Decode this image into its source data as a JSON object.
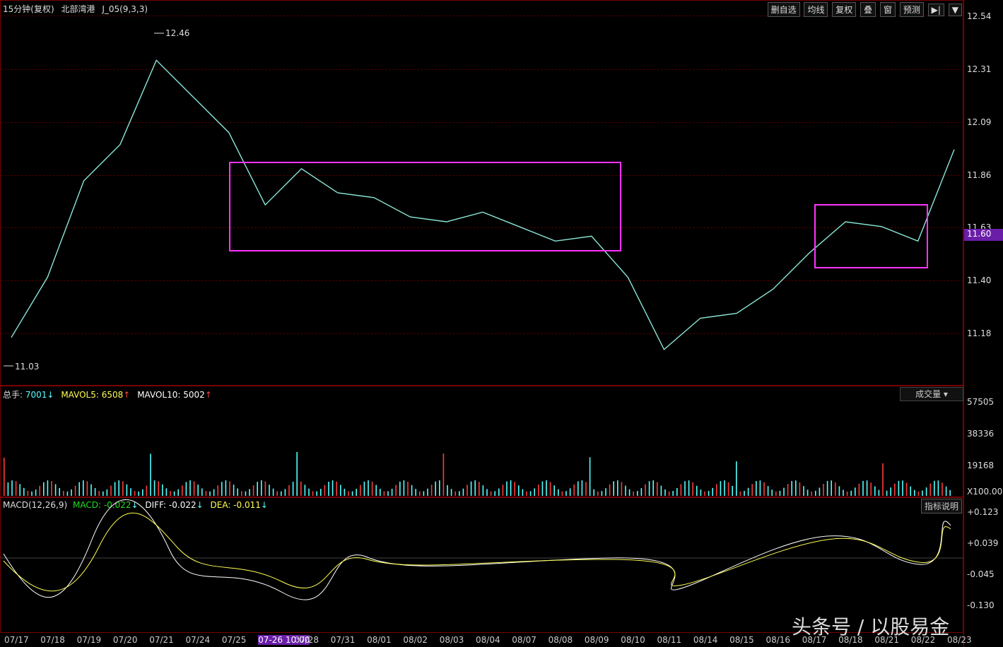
{
  "header": {
    "left_title": "15分钟(复权)",
    "symbol": "北部湾港",
    "indicator": "J_05(9,3,3)"
  },
  "toolbar": {
    "items": [
      "删自选",
      "均线",
      "复权",
      "叠",
      "窗",
      "预测"
    ]
  },
  "price_panel": {
    "high_label": "12.46",
    "low_label": "11.03",
    "y_ticks": [
      "12.54",
      "12.31",
      "12.09",
      "11.86",
      "11.63",
      "11.40",
      "11.18"
    ],
    "current_price": "11.60"
  },
  "volume_panel": {
    "title_parts": {
      "a": "总手:",
      "b": "7001",
      "c": "MAVOL5:",
      "d": "6508",
      "e": "MAVOL10:",
      "f": "5002"
    },
    "dropdown": "成交量",
    "y_ticks": [
      "57505",
      "38336",
      "19168"
    ],
    "unit": "X100.00"
  },
  "macd_panel": {
    "title_parts": {
      "a": "MACD(12,26,9)",
      "b": "MACD:",
      "c": "-0.022",
      "d": "DIFF:",
      "e": "-0.022",
      "f": "DEA:",
      "g": "-0.011"
    },
    "button": "指标说明",
    "y_ticks": [
      "+0.123",
      "+0.039",
      "-0.045",
      "-0.130"
    ]
  },
  "x_axis": {
    "dates": [
      "07/17",
      "07/18",
      "07/19",
      "07/20",
      "07/21",
      "07/24",
      "07/25",
      "07-26 10:00",
      "07/28",
      "07/31",
      "08/01",
      "08/02",
      "08/03",
      "08/04",
      "08/07",
      "08/08",
      "08/09",
      "08/10",
      "08/11",
      "08/14",
      "08/15",
      "08/16",
      "08/17",
      "08/18",
      "08/21",
      "08/22",
      "08/23"
    ]
  },
  "watermark": "头条号 / 以股易金",
  "colors": {
    "up": "#ff3b3b",
    "down": "#54ffff",
    "box": "#ff33ff",
    "buy_arrow": "#ff4040",
    "sell_arrow": "#22dd22",
    "current": "#6a1ea8"
  },
  "chart_data": {
    "type": "candlestick",
    "interval": "15min",
    "price_annotations": {
      "high": 12.46,
      "low": 11.03,
      "last": 11.6
    },
    "ylim": [
      11.0,
      12.6
    ],
    "approx_close_path": [
      {
        "x": "07/17",
        "y": 11.2
      },
      {
        "x": "07/18",
        "y": 11.45
      },
      {
        "x": "07/19",
        "y": 11.85
      },
      {
        "x": "07/20",
        "y": 12.0
      },
      {
        "x": "07/21",
        "y": 12.35
      },
      {
        "x": "07/24",
        "y": 12.2
      },
      {
        "x": "07/25",
        "y": 12.05
      },
      {
        "x": "07-26 10:00",
        "y": 11.75
      },
      {
        "x": "07/28",
        "y": 11.9
      },
      {
        "x": "07/31",
        "y": 11.8
      },
      {
        "x": "08/01",
        "y": 11.78
      },
      {
        "x": "08/02",
        "y": 11.7
      },
      {
        "x": "08/03",
        "y": 11.68
      },
      {
        "x": "08/04",
        "y": 11.72
      },
      {
        "x": "08/07",
        "y": 11.66
      },
      {
        "x": "08/08",
        "y": 11.6
      },
      {
        "x": "08/09",
        "y": 11.62
      },
      {
        "x": "08/10",
        "y": 11.45
      },
      {
        "x": "08/11",
        "y": 11.15
      },
      {
        "x": "08/14",
        "y": 11.28
      },
      {
        "x": "08/15",
        "y": 11.3
      },
      {
        "x": "08/16",
        "y": 11.4
      },
      {
        "x": "08/17",
        "y": 11.55
      },
      {
        "x": "08/18",
        "y": 11.68
      },
      {
        "x": "08/21",
        "y": 11.66
      },
      {
        "x": "08/22",
        "y": 11.6
      },
      {
        "x": "08/23",
        "y": 11.98
      }
    ],
    "volume_ticks": [
      57505,
      38336,
      19168
    ],
    "macd_ticks": [
      0.123,
      0.039,
      -0.045,
      -0.13
    ]
  }
}
